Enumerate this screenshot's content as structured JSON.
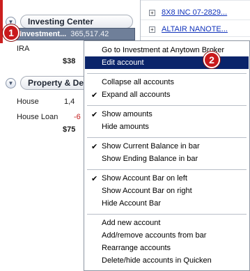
{
  "account_bar": {
    "investing_group": {
      "title": "Investing Center"
    },
    "selected_account": {
      "name": "Investment...",
      "amount": "365,517.42"
    },
    "ira": {
      "name": "IRA",
      "amount": "$38"
    },
    "property_group": {
      "title": "Property & Deb"
    },
    "house": {
      "name": "House",
      "amount": "1,4"
    },
    "house_loan": {
      "name": "House Loan",
      "amount": "-6"
    },
    "property_total": "$75"
  },
  "register": {
    "items": [
      {
        "label": "8X8 INC 07-2829..."
      },
      {
        "label": "ALTAIR NANOTE..."
      }
    ]
  },
  "badges": {
    "one": "1",
    "two": "2"
  },
  "context_menu": {
    "items": [
      {
        "label": "Go to Investment at Anytown Broker",
        "checked": false
      },
      {
        "label": "Edit account",
        "checked": false,
        "highlighted": true
      },
      {
        "label": "Collapse all accounts",
        "checked": false
      },
      {
        "label": "Expand all accounts",
        "checked": true
      },
      {
        "label": "Show amounts",
        "checked": true
      },
      {
        "label": "Hide amounts",
        "checked": false
      },
      {
        "label": "Show Current Balance in bar",
        "checked": true
      },
      {
        "label": "Show Ending Balance in bar",
        "checked": false
      },
      {
        "label": "Show Account Bar on left",
        "checked": true
      },
      {
        "label": "Show Account Bar on right",
        "checked": false
      },
      {
        "label": "Hide Account Bar",
        "checked": false
      },
      {
        "label": "Add new account",
        "checked": false
      },
      {
        "label": "Add/remove accounts from bar",
        "checked": false
      },
      {
        "label": "Rearrange accounts",
        "checked": false
      },
      {
        "label": "Delete/hide accounts in Quicken",
        "checked": false
      }
    ],
    "check_glyph": "✔"
  },
  "colors": {
    "highlight": "#0a246a",
    "selected_account": "#6f7f99",
    "badge": "#c9191c",
    "negative": "#c41c1c",
    "link": "#1133bb"
  }
}
